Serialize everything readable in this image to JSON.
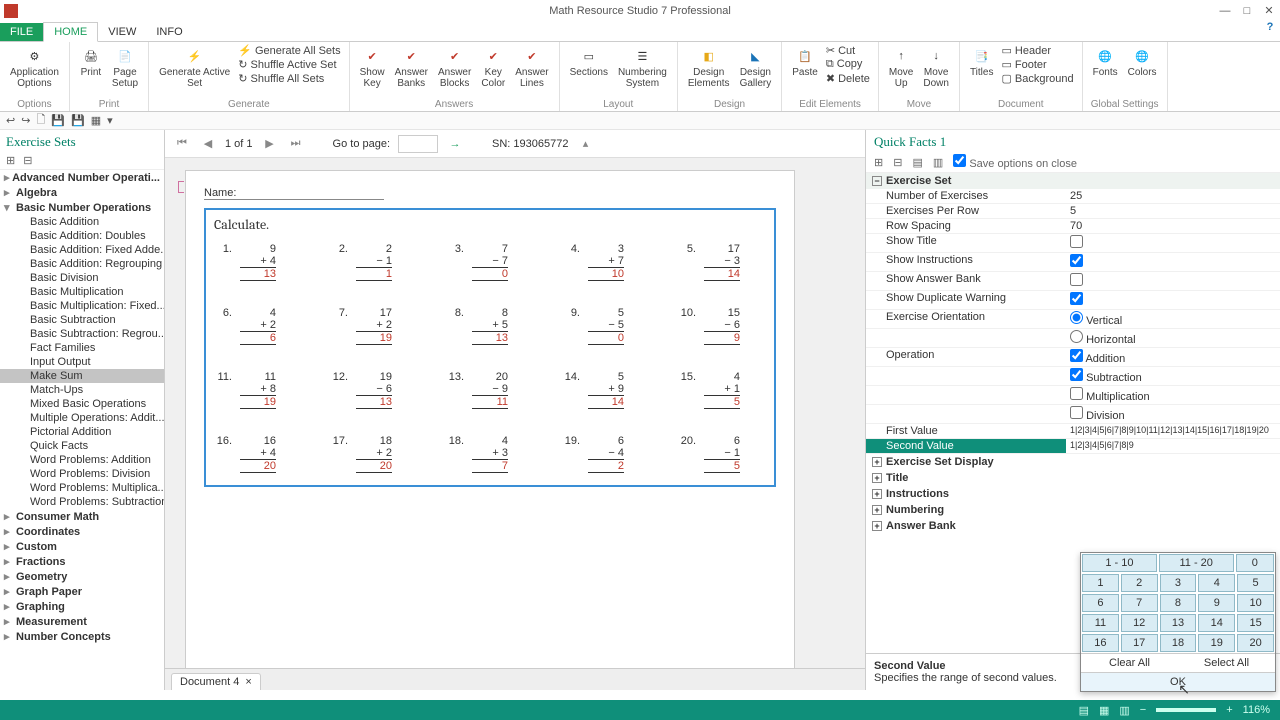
{
  "app": {
    "title": "Math Resource Studio 7 Professional"
  },
  "tabs": {
    "file": "FILE",
    "home": "HOME",
    "view": "VIEW",
    "info": "INFO"
  },
  "ribbon": {
    "options": {
      "label": "Options",
      "btn": "Application\nOptions"
    },
    "print": {
      "label": "Print",
      "print": "Print",
      "pagesetup": "Page\nSetup"
    },
    "generate": {
      "label": "Generate",
      "active": "Generate Active\nSet",
      "all": "Generate All Sets",
      "shuffleActive": "Shuffle Active Set",
      "shuffleAll": "Shuffle All Sets"
    },
    "answers": {
      "label": "Answers",
      "showkey": "Show\nKey",
      "banks": "Answer\nBanks",
      "blocks": "Answer\nBlocks",
      "keycolor": "Key\nColor",
      "lines": "Answer\nLines"
    },
    "layout": {
      "label": "Layout",
      "sections": "Sections",
      "numbering": "Numbering\nSystem"
    },
    "design": {
      "label": "Design",
      "elements": "Design\nElements",
      "gallery": "Design\nGallery"
    },
    "edit": {
      "label": "Edit Elements",
      "cut": "Cut",
      "copy": "Copy",
      "paste": "Paste",
      "delete": "Delete"
    },
    "move": {
      "label": "Move",
      "up": "Move\nUp",
      "down": "Move\nDown"
    },
    "document": {
      "label": "Document",
      "titles": "Titles",
      "header": "Header",
      "footer": "Footer",
      "background": "Background"
    },
    "global": {
      "label": "Global Settings",
      "fonts": "Fonts",
      "colors": "Colors"
    }
  },
  "leftpanel": {
    "title": "Exercise Sets",
    "cats": [
      {
        "label": "Advanced  Number  Operati...",
        "expanded": false
      },
      {
        "label": "Algebra",
        "expanded": false
      },
      {
        "label": "Basic Number Operations",
        "expanded": true,
        "children": [
          "Basic Addition",
          "Basic Addition: Doubles",
          "Basic Addition: Fixed  Adde...",
          "Basic Addition: Regrouping",
          "Basic Division",
          "Basic Multiplication",
          "Basic  Multiplication:  Fixed...",
          "Basic Subtraction",
          "Basic Subtraction: Regrou...",
          "Fact Families",
          "Input Output",
          "Make Sum",
          "Match-Ups",
          "Mixed Basic Operations",
          "Multiple Operations: Addit...",
          "Pictorial Addition",
          "Quick Facts",
          "Word Problems: Addition",
          "Word Problems: Division",
          "Word Problems: Multiplica...",
          "Word Problems: Subtraction"
        ],
        "selected": "Make Sum"
      },
      {
        "label": "Consumer Math"
      },
      {
        "label": "Coordinates"
      },
      {
        "label": "Custom"
      },
      {
        "label": "Fractions"
      },
      {
        "label": "Geometry"
      },
      {
        "label": "Graph Paper"
      },
      {
        "label": "Graphing"
      },
      {
        "label": "Measurement"
      },
      {
        "label": "Number Concepts"
      }
    ]
  },
  "nav": {
    "pageof": "1 of 1",
    "gotolabel": "Go to page:",
    "sn": "SN: 193065772"
  },
  "worksheet": {
    "name_label": "Name:",
    "instruction": "Calculate.",
    "problems": [
      {
        "n": "1.",
        "a": "9",
        "op": "+",
        "b": "4",
        "ans": "13"
      },
      {
        "n": "2.",
        "a": "2",
        "op": "−",
        "b": "1",
        "ans": "1"
      },
      {
        "n": "3.",
        "a": "7",
        "op": "−",
        "b": "7",
        "ans": "0"
      },
      {
        "n": "4.",
        "a": "3",
        "op": "+",
        "b": "7",
        "ans": "10"
      },
      {
        "n": "5.",
        "a": "17",
        "op": "−",
        "b": "3",
        "ans": "14"
      },
      {
        "n": "6.",
        "a": "4",
        "op": "+",
        "b": "2",
        "ans": "6"
      },
      {
        "n": "7.",
        "a": "17",
        "op": "+",
        "b": "2",
        "ans": "19"
      },
      {
        "n": "8.",
        "a": "8",
        "op": "+",
        "b": "5",
        "ans": "13"
      },
      {
        "n": "9.",
        "a": "5",
        "op": "−",
        "b": "5",
        "ans": "0"
      },
      {
        "n": "10.",
        "a": "15",
        "op": "−",
        "b": "6",
        "ans": "9"
      },
      {
        "n": "11.",
        "a": "11",
        "op": "+",
        "b": "8",
        "ans": "19"
      },
      {
        "n": "12.",
        "a": "19",
        "op": "−",
        "b": "6",
        "ans": "13"
      },
      {
        "n": "13.",
        "a": "20",
        "op": "−",
        "b": "9",
        "ans": "11"
      },
      {
        "n": "14.",
        "a": "5",
        "op": "+",
        "b": "9",
        "ans": "14"
      },
      {
        "n": "15.",
        "a": "4",
        "op": "+",
        "b": "1",
        "ans": "5"
      },
      {
        "n": "16.",
        "a": "16",
        "op": "+",
        "b": "4",
        "ans": "20"
      },
      {
        "n": "17.",
        "a": "18",
        "op": "+",
        "b": "2",
        "ans": "20"
      },
      {
        "n": "18.",
        "a": "4",
        "op": "+",
        "b": "3",
        "ans": "7"
      },
      {
        "n": "19.",
        "a": "6",
        "op": "−",
        "b": "4",
        "ans": "2"
      },
      {
        "n": "20.",
        "a": "6",
        "op": "−",
        "b": "1",
        "ans": "5"
      }
    ]
  },
  "doctab": {
    "name": "Document 4"
  },
  "rightpanel": {
    "title": "Quick Facts 1",
    "save": "Save options on close",
    "cat_exerciseset": "Exercise Set",
    "rows": {
      "numex": {
        "k": "Number of Exercises",
        "v": "25"
      },
      "perrow": {
        "k": "Exercises Per Row",
        "v": "5"
      },
      "spacing": {
        "k": "Row Spacing",
        "v": "70"
      },
      "showtitle": {
        "k": "Show Title",
        "v": false
      },
      "showinstr": {
        "k": "Show Instructions",
        "v": true
      },
      "showbank": {
        "k": "Show Answer Bank",
        "v": false
      },
      "showdup": {
        "k": "Show Duplicate Warning",
        "v": true
      },
      "orient": {
        "k": "Exercise Orientation",
        "v": "Vertical",
        "opts": [
          "Vertical",
          "Horizontal"
        ]
      },
      "operation": {
        "k": "Operation",
        "opts": [
          {
            "label": "Addition",
            "v": true
          },
          {
            "label": "Subtraction",
            "v": true
          },
          {
            "label": "Multiplication",
            "v": false
          },
          {
            "label": "Division",
            "v": false
          }
        ]
      },
      "first": {
        "k": "First Value",
        "v": "1|2|3|4|5|6|7|8|9|10|11|12|13|14|15|16|17|18|19|20"
      },
      "second": {
        "k": "Second Value",
        "v": "1|2|3|4|5|6|7|8|9"
      }
    },
    "cats_more": [
      "Exercise Set Display",
      "Title",
      "Instructions",
      "Numbering",
      "Answer Bank"
    ],
    "help": {
      "title": "Second Value",
      "desc": "Specifies the range of second values."
    }
  },
  "valuepop": {
    "ranges": [
      "1 - 10",
      "11 - 20",
      "0"
    ],
    "nums": [
      [
        1,
        2,
        3,
        4,
        5
      ],
      [
        6,
        7,
        8,
        9,
        10
      ],
      [
        11,
        12,
        13,
        14,
        15
      ],
      [
        16,
        17,
        18,
        19,
        20
      ]
    ],
    "clear": "Clear All",
    "selectall": "Select All",
    "ok": "OK"
  },
  "taskbar": {
    "zoom": "116%"
  }
}
